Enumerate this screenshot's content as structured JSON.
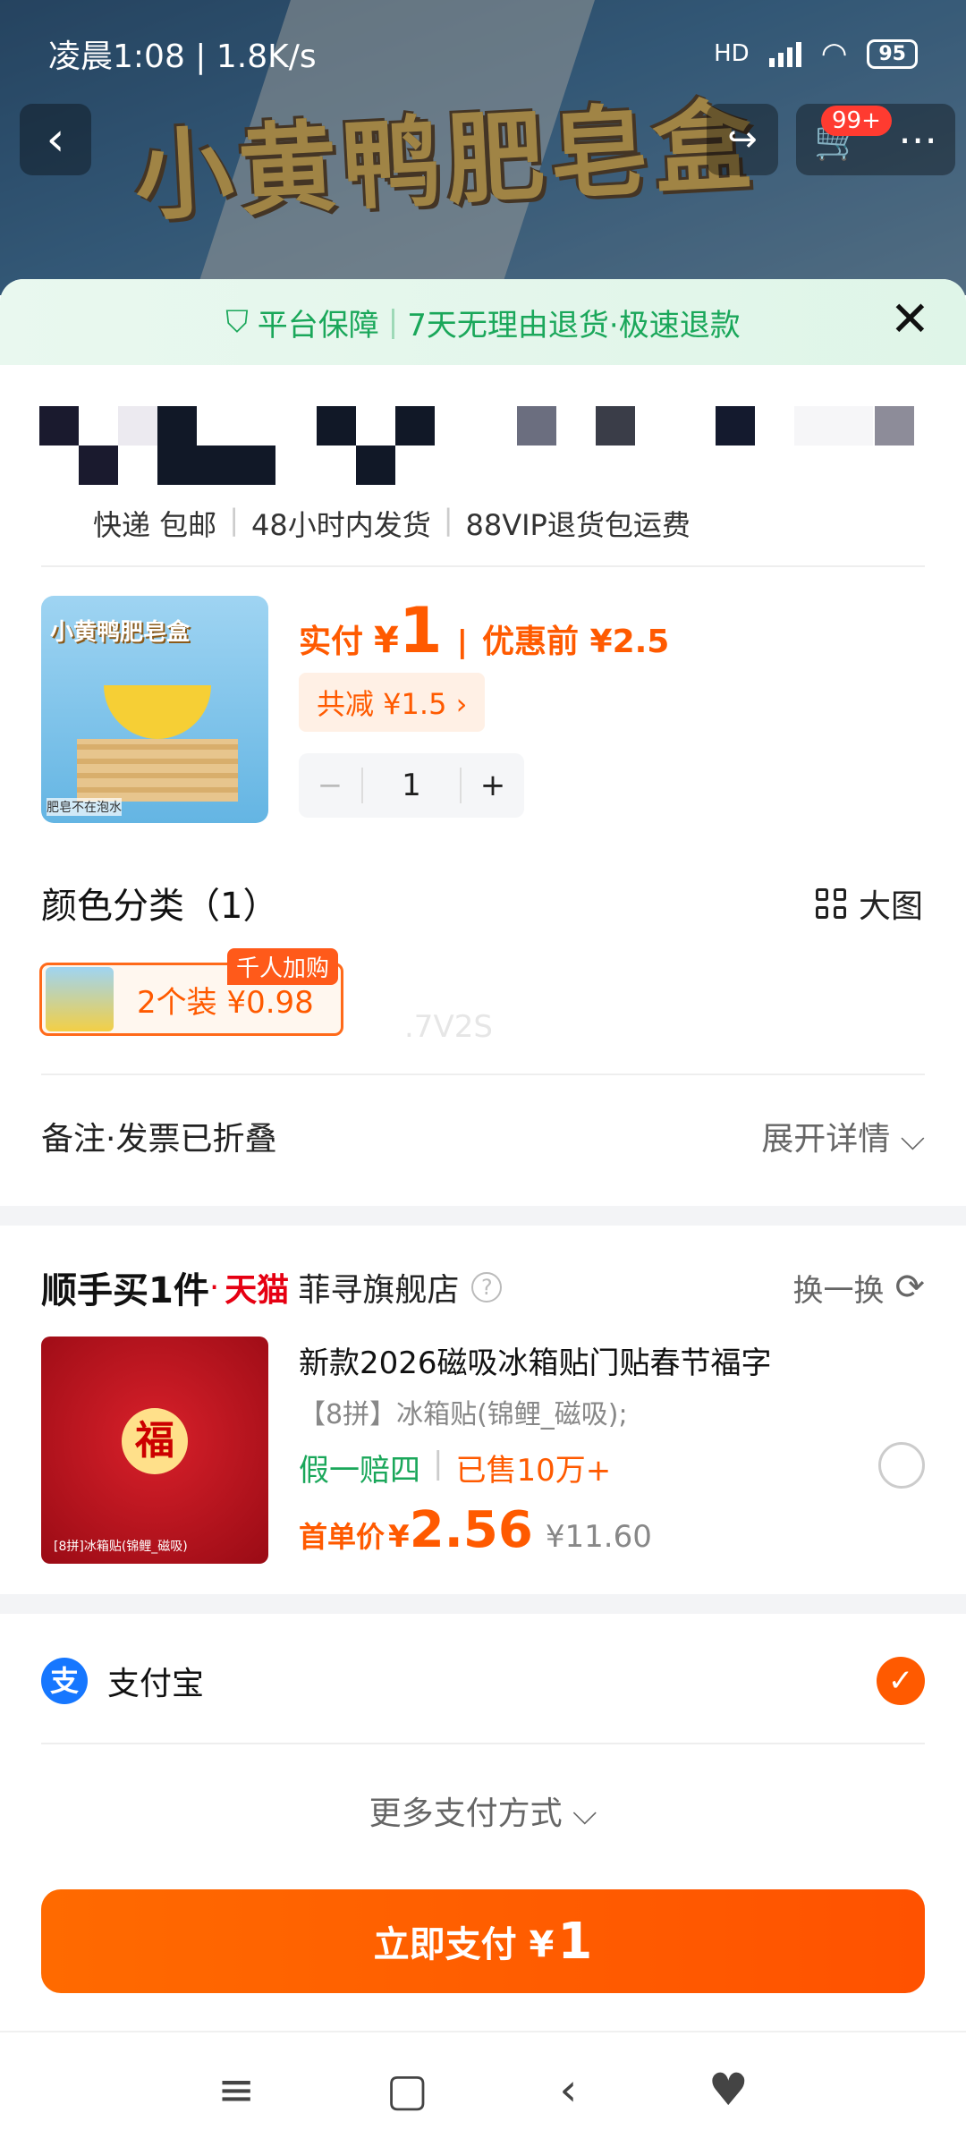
{
  "status_bar": {
    "time": "凌晨1:08 | 1.8K/s",
    "network": "HD",
    "battery": "95"
  },
  "banner": {
    "title_art": "小黄鸭肥皂盒"
  },
  "header": {
    "cart_badge": "99+"
  },
  "guarantee": {
    "label1": "平台保障",
    "label2": "7天无理由退货·极速退款"
  },
  "shipping": {
    "tags": [
      "快递 包邮",
      "48小时内发货",
      "88VIP退货包运费"
    ]
  },
  "product": {
    "image_label": "小黄鸭肥皂盒",
    "image_note": "肥皂不在泡水",
    "paid_label": "实付",
    "currency": "¥",
    "paid_amount": "1",
    "before_label": "优惠前 ¥2.5",
    "save_tag": "共减 ¥1.5 ›",
    "quantity": "1",
    "minus": "−",
    "plus": "+"
  },
  "category": {
    "title": "颜色分类（1）",
    "big_pic_label": "大图",
    "variant_text": "2个装  ¥0.98",
    "variant_badge": "千人加购"
  },
  "remarks": {
    "label": "备注·发票已折叠",
    "expand": "展开详情 ⌵"
  },
  "buy_along": {
    "heading": "顺手买1件",
    "dot": "·",
    "tmall": "天猫",
    "store": "菲寻旗舰店",
    "help": "?",
    "swap": "换一换",
    "item_title": "新款2026磁吸冰箱贴门贴春节福字",
    "item_spec": "【8拼】冰箱贴(锦鲤_磁吸);",
    "tag_guarantee": "假一赔四",
    "tag_sold": "已售10万+",
    "price_label": "首单价",
    "currency": "¥",
    "price": "2.56",
    "old_price": "¥11.60",
    "image_char": "福",
    "image_caption": "[8拼]冰箱贴(锦鲤_磁吸)"
  },
  "payment": {
    "method": "支付宝",
    "more": "更多支付方式 ⌵",
    "button_label": "立即支付 ¥",
    "button_amount": "1"
  },
  "ghost_text": ".7V2S"
}
